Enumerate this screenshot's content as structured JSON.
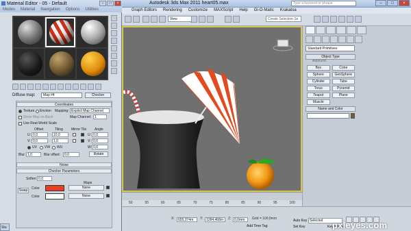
{
  "max": {
    "title": "Autodesk 3ds Max 2011      heart05.max",
    "search_placeholder": "Type a keyword or phrase",
    "menu": [
      "Graph Editors",
      "Rendering",
      "Customize",
      "MAXScript",
      "Help",
      "Gi-O-Matic",
      "Krakatoa"
    ],
    "view_dropdown": "View",
    "selection_set": "Create Selection Se",
    "viewport_label": "",
    "command_panel": {
      "primitive_dropdown": "Standard Primitives",
      "object_type_header": "Object Type",
      "autogrid_label": "AutoGrid",
      "primitives": [
        "Box",
        "Cone",
        "Sphere",
        "GeoSphere",
        "Cylinder",
        "Tube",
        "Torus",
        "Pyramid",
        "Teapot",
        "Plane",
        "Muscle"
      ],
      "name_color_header": "Name and Color",
      "swatch_color": "#7b5a2b"
    },
    "timeline_ticks": [
      "50",
      "55",
      "60",
      "65",
      "70",
      "75",
      "80",
      "85",
      "90",
      "95",
      "100"
    ],
    "status": {
      "x_label": "X:",
      "x_value": "655,374m",
      "y_label": "Y:",
      "y_value": "1284,468m",
      "z_label": "Z:",
      "z_value": "0,0mm",
      "grid_label": "Grid = 100,0mm",
      "add_time_tag": "Add Time Tag",
      "auto_key": "Auto Key",
      "set_key": "Set Key",
      "selected": "Selected",
      "key_filters": "Key Filters..."
    },
    "taskbar_item": "Stu"
  },
  "material_editor": {
    "title": "Material Editor - 05 - Default",
    "menu": [
      "Modes",
      "Material",
      "Navigation",
      "Options",
      "Utilities"
    ],
    "diffuse_label": "Diffuse map:",
    "map_name": "Map #4",
    "map_type": "Checker",
    "coordinates_header": "Coordinates",
    "texture_label": "Texture",
    "environ_label": "Environ",
    "mapping_label": "Mapping:",
    "mapping_value": "Explicit Map Channel",
    "show_map_backside": "Show Map on Back",
    "map_channel_label": "Map Channel:",
    "map_channel_value": "1",
    "real_world_scale": "Use Real-World Scale",
    "offset_header": "Offset",
    "tiling_header": "Tiling",
    "mirror_tile_header": "Mirror Tile",
    "angle_header": "Angle",
    "u_label": "U:",
    "v_label": "V:",
    "w_label": "W:",
    "u_offset": "0,0",
    "v_offset": "0,0",
    "u_tiling": "10,0",
    "v_tiling": "1,0",
    "u_angle": "0,0",
    "v_angle": "0,0",
    "w_angle": "0,0",
    "uv_label": "UV",
    "vw_label": "VW",
    "wu_label": "WU",
    "blur_label": "Blur:",
    "blur_value": "1,0",
    "blur_offset_label": "Blur offset:",
    "blur_offset_value": "0,0",
    "rotate_label": "Rotate",
    "noise_header": "Noise",
    "checker_params_header": "Checker Parameters",
    "soften_label": "Soften:",
    "soften_value": "0,0",
    "maps_label": "Maps",
    "swap_label": "Swap",
    "color_label": "Color",
    "color1": "#e8411e",
    "color2": "#ffffff",
    "none_label": "None"
  },
  "watermark": "pxleyes.com"
}
